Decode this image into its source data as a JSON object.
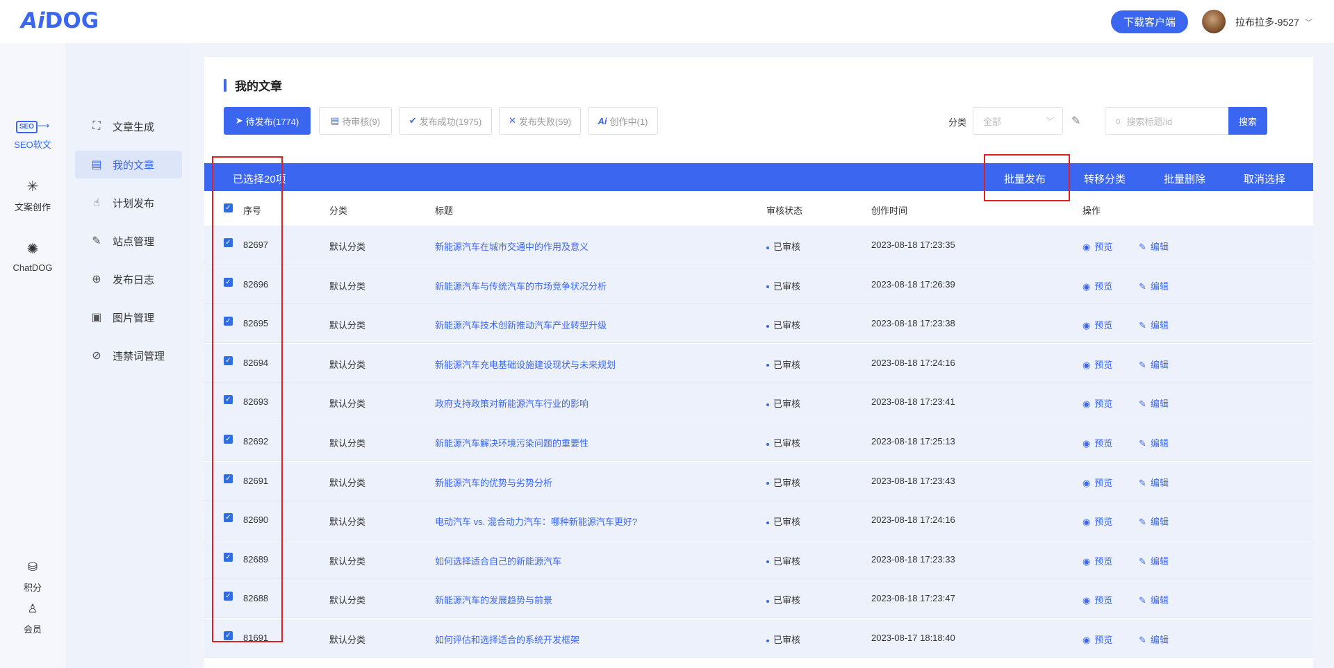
{
  "header": {
    "logo_ai": "Ai",
    "logo_dog": "DOG",
    "download_label": "下载客户端",
    "username": "拉布拉多-9527"
  },
  "rail": {
    "items": [
      {
        "label": "SEO软文",
        "badge": "SEO",
        "icon": "seo-icon"
      },
      {
        "label": "文案创作",
        "icon": "sparkle-icon"
      },
      {
        "label": "ChatDOG",
        "icon": "openai-icon"
      },
      {
        "label": "积分",
        "icon": "coins-icon"
      },
      {
        "label": "会员",
        "icon": "user-icon"
      }
    ]
  },
  "submenu": {
    "items": [
      {
        "label": "文章生成",
        "icon": "scan-icon"
      },
      {
        "label": "我的文章",
        "icon": "article-icon"
      },
      {
        "label": "计划发布",
        "icon": "hand-pointer-icon"
      },
      {
        "label": "站点管理",
        "icon": "site-icon"
      },
      {
        "label": "发布日志",
        "icon": "globe-icon"
      },
      {
        "label": "图片管理",
        "icon": "image-icon"
      },
      {
        "label": "违禁词管理",
        "icon": "forbidden-word-icon"
      }
    ]
  },
  "main": {
    "title": "我的文章",
    "tabs": [
      {
        "label": "待发布(1774)",
        "icon": "send-icon"
      },
      {
        "label": "待审核(9)",
        "icon": "review-icon"
      },
      {
        "label": "发布成功(1975)",
        "icon": "check-icon"
      },
      {
        "label": "发布失败(59)",
        "icon": "x-icon"
      },
      {
        "label": "创作中(1)",
        "icon": "ai-icon"
      }
    ],
    "category_label": "分类",
    "category_value": "全部",
    "search_placeholder": "搜索标题/id",
    "search_button": "搜索",
    "selection": {
      "count_label": "已选择20项",
      "actions": [
        "批量发布",
        "转移分类",
        "批量删除",
        "取消选择"
      ]
    },
    "columns": [
      "序号",
      "分类",
      "标题",
      "审核状态",
      "创作时间",
      "操作"
    ],
    "preview_label": "预览",
    "edit_label": "编辑",
    "rows": [
      {
        "id": "82697",
        "category": "默认分类",
        "title": "新能源汽车在城市交通中的作用及意义",
        "status": "已审核",
        "time": "2023-08-18 17:23:35"
      },
      {
        "id": "82696",
        "category": "默认分类",
        "title": "新能源汽车与传统汽车的市场竞争状况分析",
        "status": "已审核",
        "time": "2023-08-18 17:26:39"
      },
      {
        "id": "82695",
        "category": "默认分类",
        "title": "新能源汽车技术创新推动汽车产业转型升级",
        "status": "已审核",
        "time": "2023-08-18 17:23:38"
      },
      {
        "id": "82694",
        "category": "默认分类",
        "title": "新能源汽车充电基础设施建设现状与未来规划",
        "status": "已审核",
        "time": "2023-08-18 17:24:16"
      },
      {
        "id": "82693",
        "category": "默认分类",
        "title": "政府支持政策对新能源汽车行业的影响",
        "status": "已审核",
        "time": "2023-08-18 17:23:41"
      },
      {
        "id": "82692",
        "category": "默认分类",
        "title": "新能源汽车解决环境污染问题的重要性",
        "status": "已审核",
        "time": "2023-08-18 17:25:13"
      },
      {
        "id": "82691",
        "category": "默认分类",
        "title": "新能源汽车的优势与劣势分析",
        "status": "已审核",
        "time": "2023-08-18 17:23:43"
      },
      {
        "id": "82690",
        "category": "默认分类",
        "title": "电动汽车 vs. 混合动力汽车：哪种新能源汽车更好?",
        "status": "已审核",
        "time": "2023-08-18 17:24:16"
      },
      {
        "id": "82689",
        "category": "默认分类",
        "title": "如何选择适合自己的新能源汽车",
        "status": "已审核",
        "time": "2023-08-18 17:23:33"
      },
      {
        "id": "82688",
        "category": "默认分类",
        "title": "新能源汽车的发展趋势与前景",
        "status": "已审核",
        "time": "2023-08-18 17:23:47"
      },
      {
        "id": "81691",
        "category": "默认分类",
        "title": "如何评估和选择适合的系统开发框架",
        "status": "已审核",
        "time": "2023-08-17 18:18:40"
      }
    ]
  }
}
